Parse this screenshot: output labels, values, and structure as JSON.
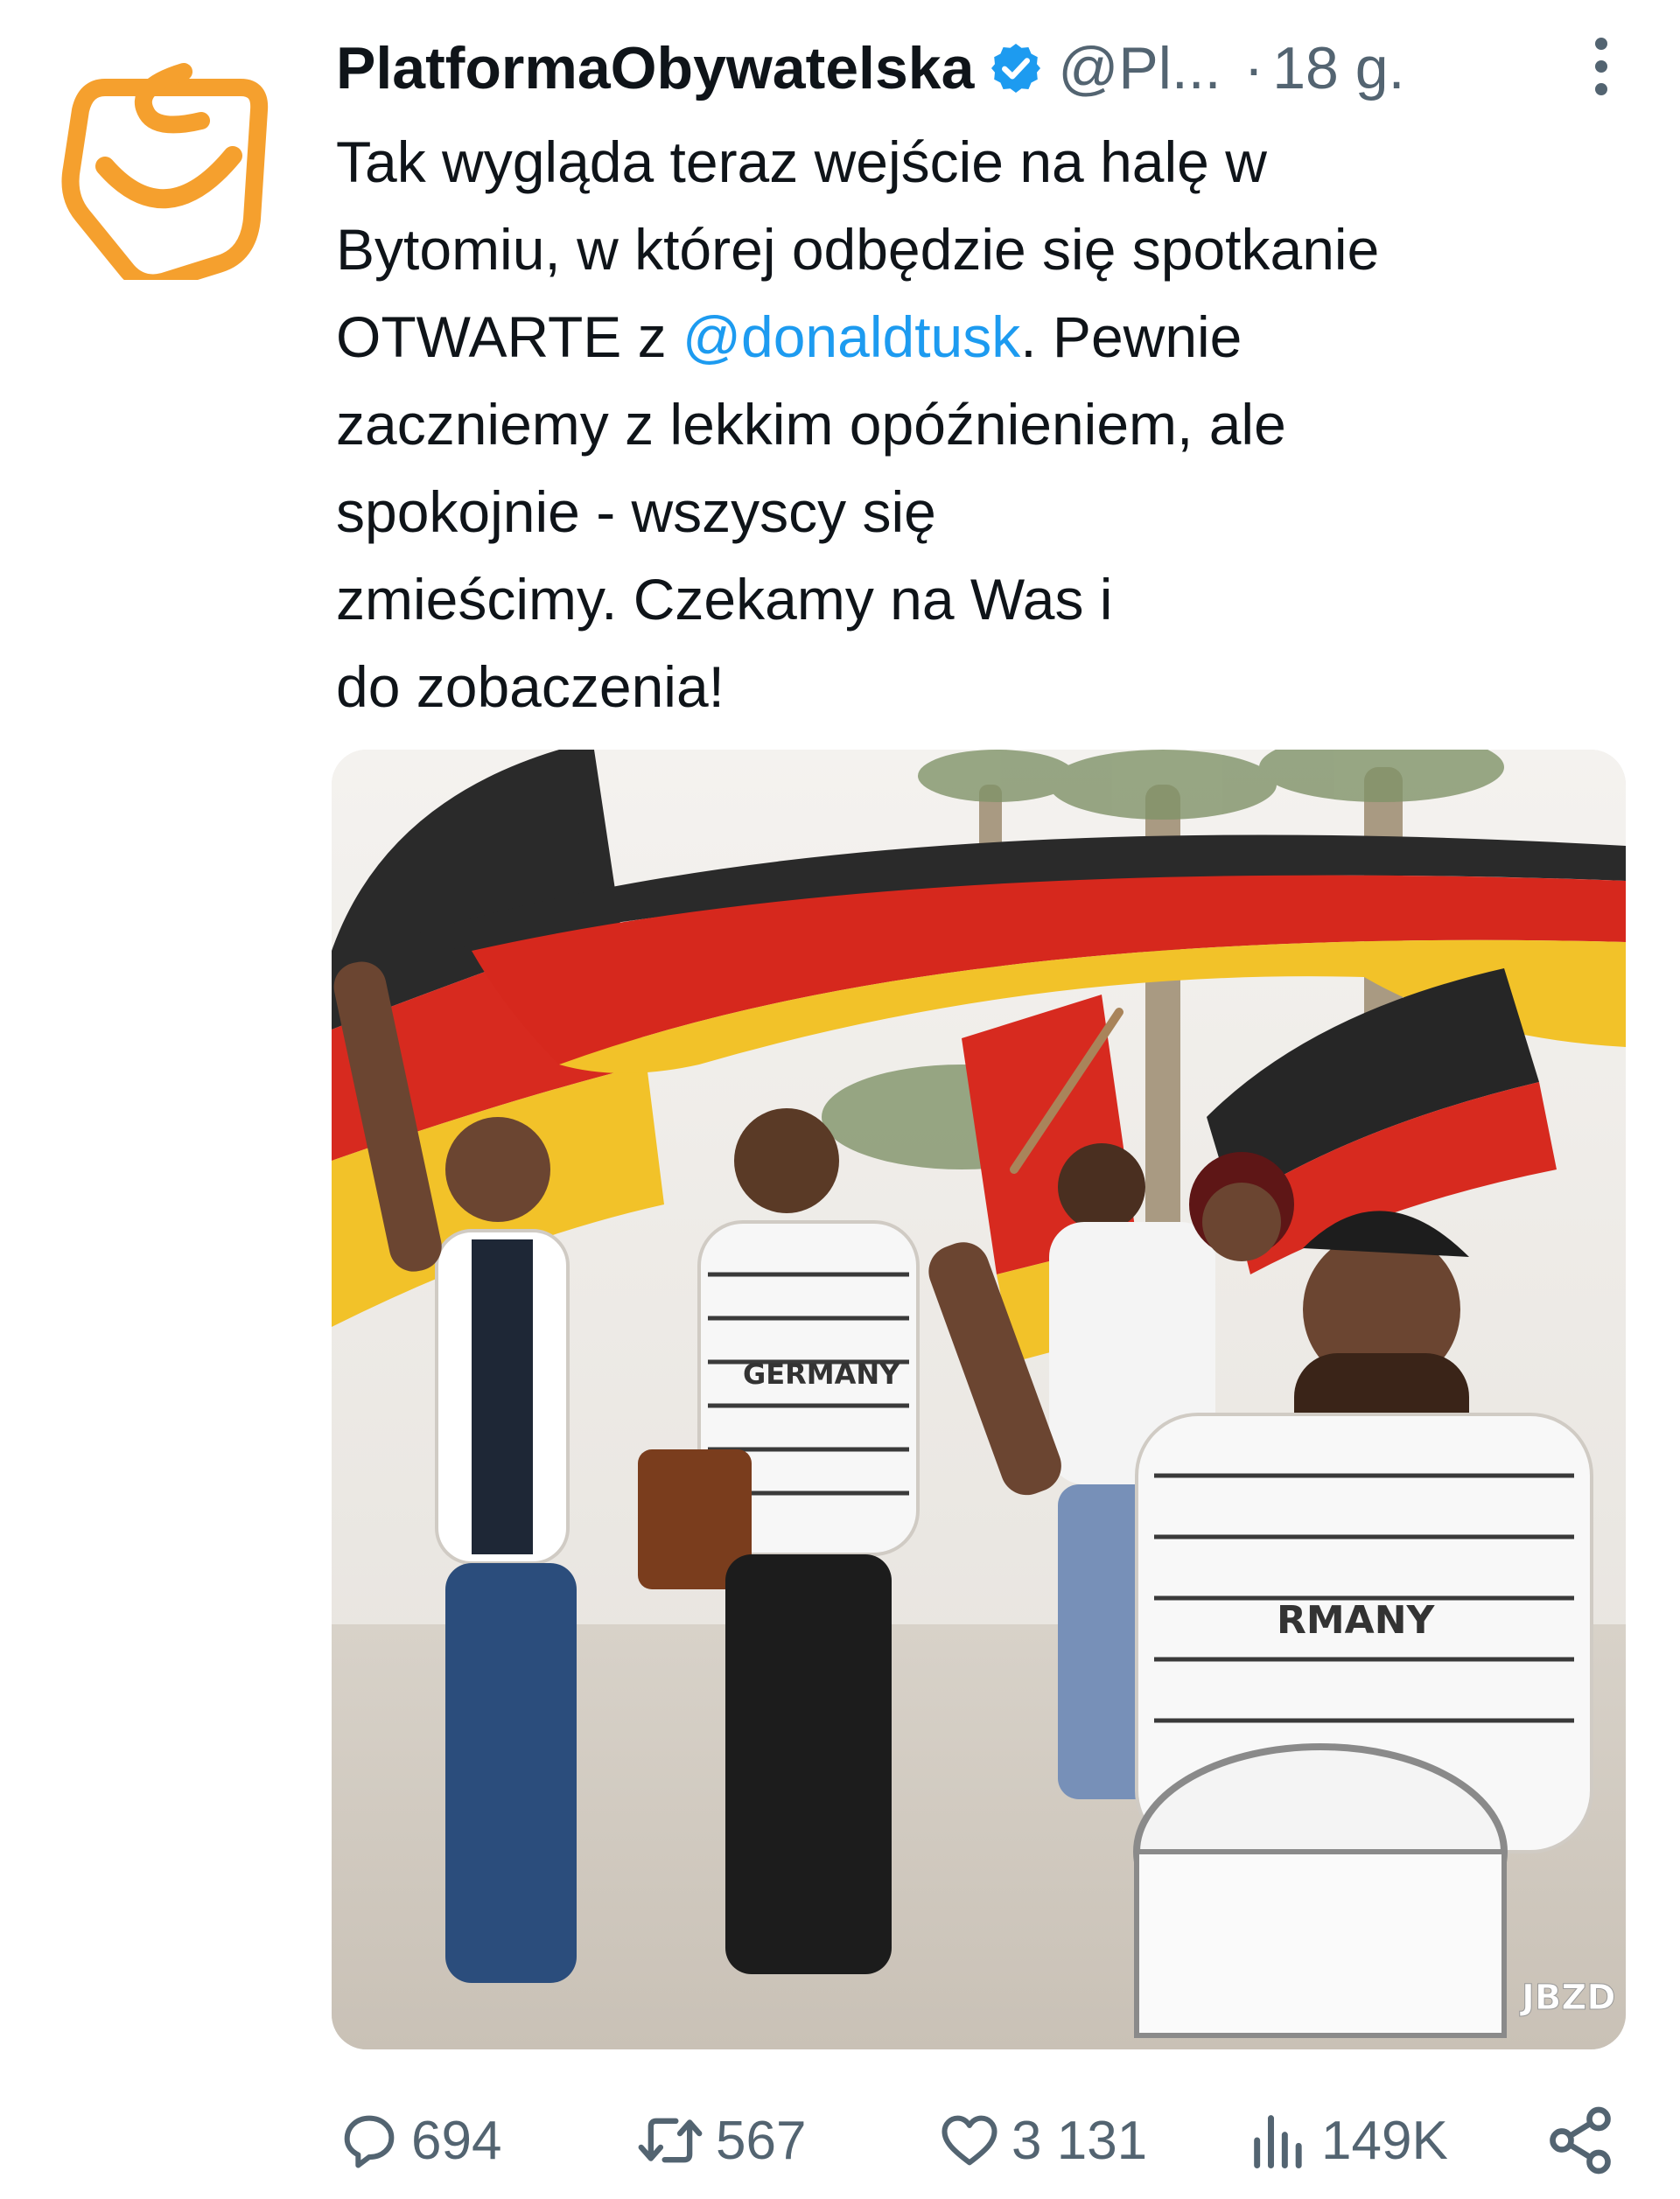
{
  "post": {
    "display_name": "PlatformaObywatelska",
    "handle": "@Pl...",
    "separator": "·",
    "time": "18 g.",
    "text_lines": [
      {
        "before": "Tak wygląda teraz wejście na halę w",
        "mention": "",
        "after": ""
      },
      {
        "before": "Bytomiu, w której odbędzie się spotkanie",
        "mention": "",
        "after": ""
      },
      {
        "before": "OTWARTE z ",
        "mention": "@donaldtusk",
        "after": ". Pewnie"
      },
      {
        "before": "zaczniemy z lekkim opóźnieniem, ale",
        "mention": "",
        "after": ""
      },
      {
        "before": "spokojnie - wszyscy się",
        "mention": "",
        "after": ""
      },
      {
        "before": "zmieścimy. Czekamy na Was i",
        "mention": "",
        "after": ""
      },
      {
        "before": "do zobaczenia!",
        "mention": "",
        "after": ""
      }
    ]
  },
  "media": {
    "shirt_text_left": "GERMANY",
    "shirt_text_right": "RMANY",
    "watermark": "JBZD"
  },
  "actions": {
    "replies": "694",
    "reposts": "567",
    "likes": "3 131",
    "views": "149K"
  },
  "colors": {
    "link": "#1d9bf0",
    "secondary_text": "#536471",
    "verified": "#1d9bf0",
    "logo_orange": "#f5a02e"
  },
  "icons": [
    "logo-icon",
    "verified-badge-icon",
    "more-options-icon",
    "reply-icon",
    "repost-icon",
    "like-icon",
    "views-icon",
    "share-icon"
  ]
}
